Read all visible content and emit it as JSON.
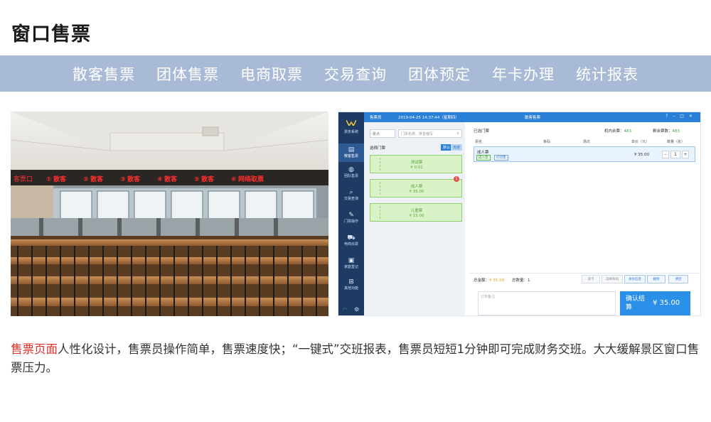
{
  "page": {
    "title": "窗口售票"
  },
  "nav": {
    "items": [
      "散客售票",
      "团体售票",
      "电商取票",
      "交易查询",
      "团体预定",
      "年卡办理",
      "统计报表"
    ]
  },
  "photo": {
    "led_left": "客票口",
    "led_windows": [
      "散客",
      "散客",
      "散客",
      "散客",
      "散客",
      "网络取票"
    ],
    "led_numbers": [
      "①",
      "②",
      "③",
      "④",
      "⑤",
      "⑥"
    ]
  },
  "app": {
    "logo": "票务系统",
    "operator": "售票员",
    "datetime": "2019-04-25 14:37:44（星期四）",
    "window_title": "散客售票",
    "sidebar": [
      {
        "label": "散客售票",
        "icon": "ticket-icon"
      },
      {
        "label": "团队售票",
        "icon": "globe-icon"
      },
      {
        "label": "交易查询",
        "icon": "search-icon"
      },
      {
        "label": "门票操作",
        "icon": "edit-icon"
      },
      {
        "label": "电商出票",
        "icon": "cart-icon"
      },
      {
        "label": "家庭登记",
        "icon": "photo-icon"
      },
      {
        "label": "其他功能",
        "icon": "grid-icon"
      }
    ],
    "left": {
      "select": "景点",
      "search_placeholder": "门票名称、拼音缩写",
      "select_label": "选择门票",
      "toggle_default": "默认",
      "toggle_hot": "热度",
      "tickets": [
        {
          "name": "测试票",
          "price": "¥ 0.01"
        },
        {
          "name": "成人票",
          "price": "¥ 35.00",
          "badge": "1"
        },
        {
          "name": "儿童票",
          "price": "¥ 15.00"
        }
      ]
    },
    "right": {
      "selected_label": "已选门票",
      "machine_remaining_label": "机内余票：",
      "machine_remaining": "483",
      "stock_label": "剩余票数：",
      "stock": "483",
      "columns": [
        "票名",
        "条码",
        "场次",
        "单价（元）",
        "数量（张）"
      ],
      "row": {
        "name": "成人票",
        "tag1": "成人票",
        "tag2": "打印票",
        "price": "¥ 35.00",
        "qty": "1",
        "minus": "-",
        "plus": "+"
      },
      "total_label": "总金额：",
      "total": "¥ 35.00",
      "count_label": "总数量：",
      "count": "1",
      "buttons": [
        "读卡",
        "选择条码",
        "身份信息",
        "删除",
        "清空"
      ],
      "remark_placeholder": "订单备注",
      "pay_label": "确认结算",
      "pay_amount": "¥ 35.00"
    }
  },
  "description": {
    "highlight": "售票页面",
    "text": "人性化设计，售票员操作简单，售票速度快；“一键式”交班报表，售票员短短1分钟即可完成财务交班。大大缓解景区窗口售票压力。"
  }
}
